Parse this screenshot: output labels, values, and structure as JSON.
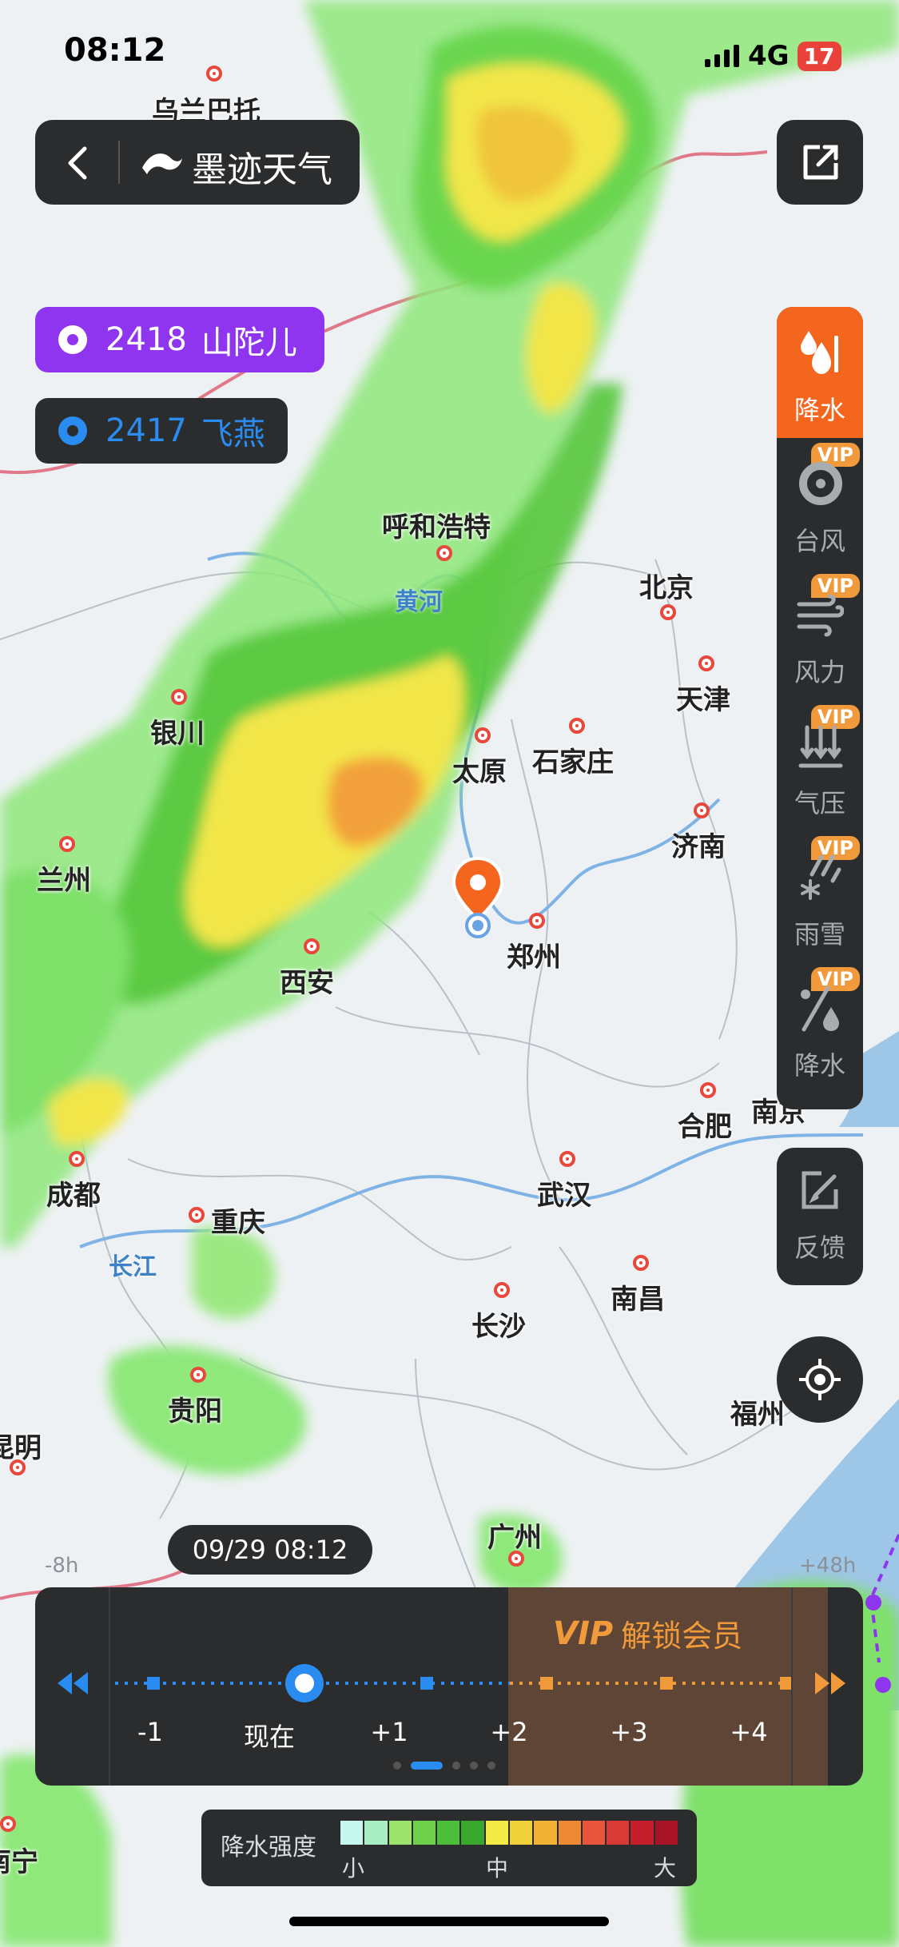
{
  "status_bar": {
    "time": "08:12",
    "network": "4G",
    "battery": "17"
  },
  "header": {
    "app_name": "墨迹天气"
  },
  "typhoons": [
    {
      "id": "2418",
      "name": "山陀儿"
    },
    {
      "id": "2417",
      "name": "飞燕"
    }
  ],
  "layers": [
    {
      "label": "降水",
      "icon": "rain-drops-icon",
      "active": true,
      "vip": ""
    },
    {
      "label": "台风",
      "icon": "typhoon-icon",
      "active": false,
      "vip": "VIP"
    },
    {
      "label": "风力",
      "icon": "wind-icon",
      "active": false,
      "vip": "VIP"
    },
    {
      "label": "气压",
      "icon": "pressure-icon",
      "active": false,
      "vip": "VIP"
    },
    {
      "label": "雨雪",
      "icon": "rain-snow-icon",
      "active": false,
      "vip": "VIP"
    },
    {
      "label": "降水",
      "icon": "precip-probability-icon",
      "active": false,
      "vip": "VIP"
    }
  ],
  "feedback": {
    "label": "反馈"
  },
  "cities": [
    {
      "name": "乌兰巴托"
    },
    {
      "name": "呼和浩特"
    },
    {
      "name": "北京"
    },
    {
      "name": "天津"
    },
    {
      "name": "银川"
    },
    {
      "name": "太原"
    },
    {
      "name": "石家庄"
    },
    {
      "name": "兰州"
    },
    {
      "name": "济南"
    },
    {
      "name": "郑州"
    },
    {
      "name": "西安"
    },
    {
      "name": "合肥"
    },
    {
      "name": "南京"
    },
    {
      "name": "成都"
    },
    {
      "name": "重庆"
    },
    {
      "name": "武汉"
    },
    {
      "name": "南昌"
    },
    {
      "name": "长沙"
    },
    {
      "name": "贵阳"
    },
    {
      "name": "昆明"
    },
    {
      "name": "福州"
    },
    {
      "name": "广州"
    },
    {
      "name": "南宁"
    }
  ],
  "rivers": [
    {
      "name": "黄河"
    },
    {
      "name": "长江"
    }
  ],
  "edge_labels": {
    "minus_8h": "-8h",
    "plus_48h": "+48h"
  },
  "timeline": {
    "datetime": "09/29 08:12",
    "unlock_text": "解锁会员",
    "vip_text": "VIP",
    "ticks": [
      "-1",
      "现在",
      "+1",
      "+2",
      "+3",
      "+4"
    ],
    "page_count": 5,
    "active_page": 1
  },
  "legend": {
    "title": "降水强度",
    "low": "小",
    "mid": "中",
    "high": "大",
    "colors": [
      "#c8f7ef",
      "#a8f0c4",
      "#9be36a",
      "#6fd14b",
      "#4cbf3a",
      "#3aa82e",
      "#f4ea45",
      "#f2d23a",
      "#f2b236",
      "#ef8a34",
      "#e8553a",
      "#d93a35",
      "#c41f2b",
      "#a81425"
    ]
  },
  "colors": {
    "accent_orange": "#f4651e",
    "typhoon_purple": "#8f35f0",
    "typhoon_blue": "#2a8cf0"
  }
}
